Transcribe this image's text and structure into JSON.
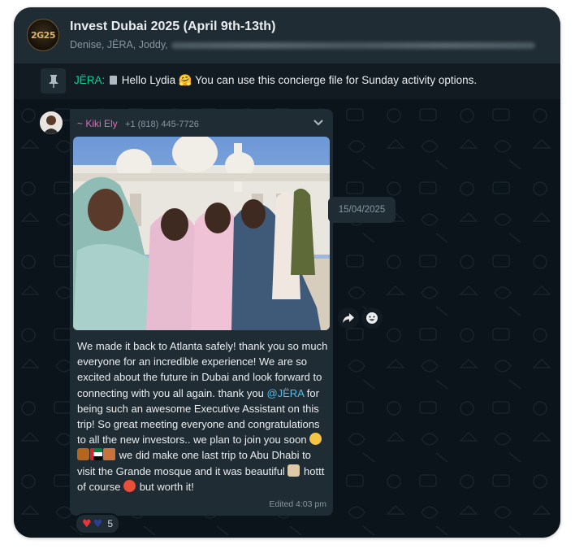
{
  "header": {
    "group_avatar_text": "2G25",
    "title": "Invest Dubai 2025 (April 9th-13th)",
    "members_visible": "Denise, JËRA, Joddy,"
  },
  "pinned": {
    "author": "JËRA:",
    "text": "Hello Lydia 🤗 You can use this concierge file for Sunday activity options."
  },
  "date_badge": "15/04/2025",
  "message": {
    "sender_name": "~ Kiki Ely",
    "sender_phone": "+1 (818) 445-7726",
    "text_part1": "We made it back to Atlanta safely! thank you so much everyone for an incredible experience! We are so  excited about the future in Dubai and look forward to connecting with you all again. thank you ",
    "mention": "@JËRA",
    "text_part2": " for being such an awesome Executive Assistant on this trip! So great meeting everyone and congratulations to all the new investors.. we plan to join you soon ",
    "text_part3": " we did make one last trip to Abu Dhabi to visit the Grande mosque and it was beautiful ",
    "text_part4": " hottt of course ",
    "text_part5": " but worth it!",
    "edited": "Edited 4:03 pm"
  },
  "reactions": {
    "count": "5",
    "emojis": [
      "red-heart",
      "blue-heart"
    ]
  },
  "icons": {
    "pin": "pin-icon",
    "chevron": "chevron-down-icon",
    "forward": "forward-icon",
    "react": "emoji-react-icon"
  },
  "colors": {
    "header_bg": "#202c33",
    "chat_bg": "#0b141a",
    "bubble_bg": "#202c33",
    "author_green": "#06cf9c",
    "sender_pink": "#e26ab6",
    "mention_blue": "#53bdeb"
  }
}
